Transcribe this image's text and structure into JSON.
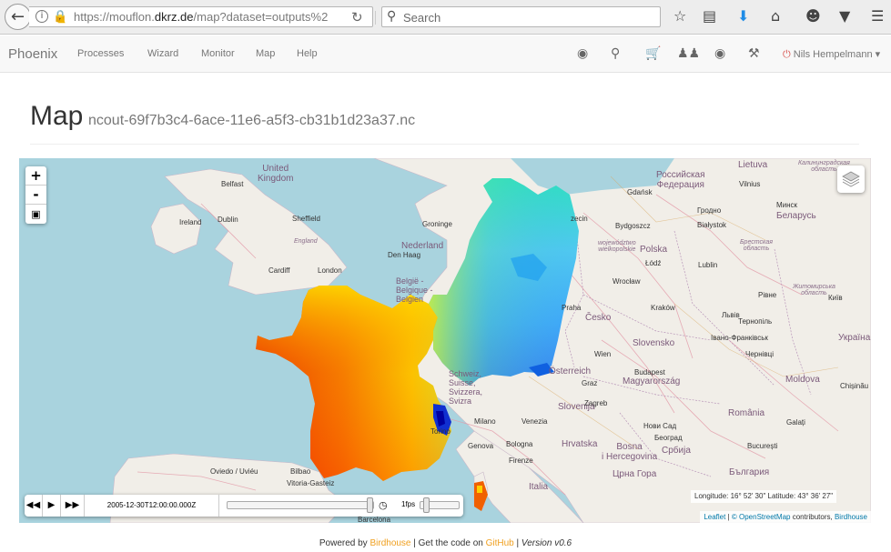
{
  "browser": {
    "url_prefix": "https://mouflon.",
    "url_domain": "dkrz.de",
    "url_path": "/map?dataset=outputs%2",
    "search_placeholder": "Search"
  },
  "navbar": {
    "brand": "Phoenix",
    "links": [
      "Processes",
      "Wizard",
      "Monitor",
      "Map",
      "Help"
    ],
    "user": "Nils Hempelmann"
  },
  "page": {
    "title": "Map",
    "subtitle": "ncout-69f7b3c4-6ace-11e6-a5f3-cb31b1d23a37.nc"
  },
  "map": {
    "zoom_in": "+",
    "zoom_out": "-",
    "coords": "Longitude: 16° 52' 30\" Latitude: 43° 36' 27\"",
    "attribution": {
      "leaflet": "Leaflet",
      "osm": "© OpenStreetMap",
      "contributors": "contributors,",
      "birdhouse": "Birdhouse"
    },
    "labels": {
      "united_kingdom": "United\nKingdom",
      "ireland": "Ireland",
      "dublin": "Dublin",
      "belfast": "Belfast",
      "sheffield": "Sheffield",
      "england": "England",
      "cardiff": "Cardiff",
      "london": "London",
      "den_haag": "Den Haag",
      "groningen": "Groninge",
      "nederland": "Nederland",
      "belgie": "België -\nBelgique -\nBelgien",
      "schweiz": "Schweiz,\nSuisse,\nSvizzera,\nSvizra",
      "torino": "Torino",
      "milano": "Milano",
      "venezia": "Venezia",
      "genova": "Genova",
      "bologna": "Bologna",
      "firenze": "Firenze",
      "italia": "Italia",
      "oviedo": "Oviedo / Uviéu",
      "bilbao": "Bilbao",
      "vitoria": "Vitoria-Gasteiz",
      "barcelona": "Barcelona",
      "gdansk": "Gdańsk",
      "szczecin": "zecin",
      "bydgoszcz": "Bydgoszcz",
      "polska": "Polska",
      "wojewodztwo": "województwo\nwielkopolskie",
      "lodz": "Łódź",
      "wroclaw": "Wrocław",
      "krakow": "Kraków",
      "praha": "Praha",
      "cesko": "Česko",
      "wien": "Wien",
      "slovensko": "Slovensko",
      "budapest": "Budapest",
      "magyarorszag": "Magyarország",
      "osterreich": "Österreich",
      "graz": "Graz",
      "slovenija": "Slovenija",
      "zagreb": "Zagreb",
      "hrvatska": "Hrvatska",
      "bosna": "Bosna\ni Hercegovina",
      "novi_sad": "Нови Сад",
      "beograd": "Београд",
      "srbija": "Србија",
      "crna_gora": "Црна Гора",
      "romania": "România",
      "bucuresti": "București",
      "galati": "Galați",
      "bulgaria": "България",
      "moldova": "Moldova",
      "lietuva": "Lietuva",
      "vilnius": "Vilnius",
      "rossiyskaya": "Российская\nФедерация",
      "kaliningrad": "Калининградская\nобласть",
      "grodno": "Гродно",
      "bialystok": "Białystok",
      "minsk": "Минск",
      "belarus": "Беларусь",
      "brest": "Брестская\nобласть",
      "rivne": "Рівне",
      "zhytomyr": "Житомирська\nобласть",
      "kyiv": "Київ",
      "lviv": "Львів",
      "ternopil": "Тернопіль",
      "ivano": "Івано-Франківськ",
      "chernivtsi": "Чернівці",
      "ukraina": "Україна",
      "lublin": "Lublin",
      "chisinau": "Chișinău"
    }
  },
  "timecontrol": {
    "date": "2005-12-30T12:00:00.000Z",
    "fps": "1fps",
    "progress": 1.0
  },
  "footer": {
    "powered_by": "Powered by",
    "birdhouse": "Birdhouse",
    "code_text": "| Get the code on",
    "github": "GitHub",
    "version": "Version v0.6"
  },
  "colors": {
    "heatmap_low": "#0000cc",
    "heatmap_high": "#e60000",
    "map_sea": "#a9d3de",
    "map_land": "#f1eee8"
  }
}
